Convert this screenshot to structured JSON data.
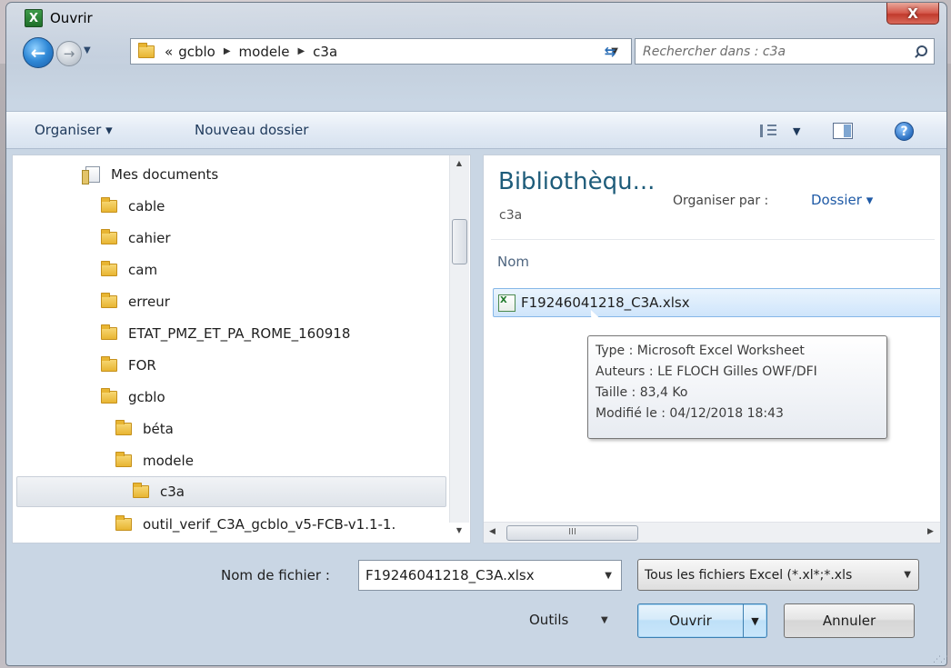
{
  "window": {
    "title": "Ouvrir",
    "close_label": "X"
  },
  "address": {
    "overflow": "«",
    "crumbs": [
      "gcblo",
      "modele",
      "c3a"
    ],
    "search_placeholder": "Rechercher dans : c3a"
  },
  "toolbar": {
    "organize": "Organiser ▾",
    "new_folder": "Nouveau dossier",
    "help": "?"
  },
  "tree": {
    "items": [
      {
        "label": "Mes documents",
        "type": "library"
      },
      {
        "label": "cable",
        "type": "folder"
      },
      {
        "label": "cahier",
        "type": "folder"
      },
      {
        "label": "cam",
        "type": "folder"
      },
      {
        "label": "erreur",
        "type": "folder"
      },
      {
        "label": "ETAT_PMZ_ET_PA_ROME_160918",
        "type": "folder"
      },
      {
        "label": "FOR",
        "type": "folder"
      },
      {
        "label": "gcblo",
        "type": "folder"
      },
      {
        "label": "béta",
        "type": "folder"
      },
      {
        "label": "modele",
        "type": "folder"
      },
      {
        "label": "c3a",
        "type": "folder",
        "selected": true
      },
      {
        "label": "outil_verif_C3A_gcblo_v5-FCB-v1.1-1.",
        "type": "folder"
      }
    ]
  },
  "library": {
    "title": "Bibliothèqu...",
    "subtitle": "c3a",
    "arrange_label": "Organiser par :",
    "arrange_value": "Dossier ▾",
    "column_name": "Nom",
    "scroll_thumb": "III"
  },
  "file": {
    "name": "F19246041218_C3A.xlsx"
  },
  "tooltip": {
    "type": "Type : Microsoft Excel Worksheet",
    "authors": "Auteurs : LE FLOCH Gilles OWF/DFI",
    "size": "Taille : 83,4 Ko",
    "modified": "Modifié le : 04/12/2018 18:43"
  },
  "bottom": {
    "filename_label": "Nom de fichier :",
    "filename_value": "F19246041218_C3A.xlsx",
    "filter_value": "Tous les fichiers Excel (*.xl*;*.xls",
    "tools_label": "Outils",
    "open_label": "Ouvrir",
    "cancel_label": "Annuler"
  }
}
